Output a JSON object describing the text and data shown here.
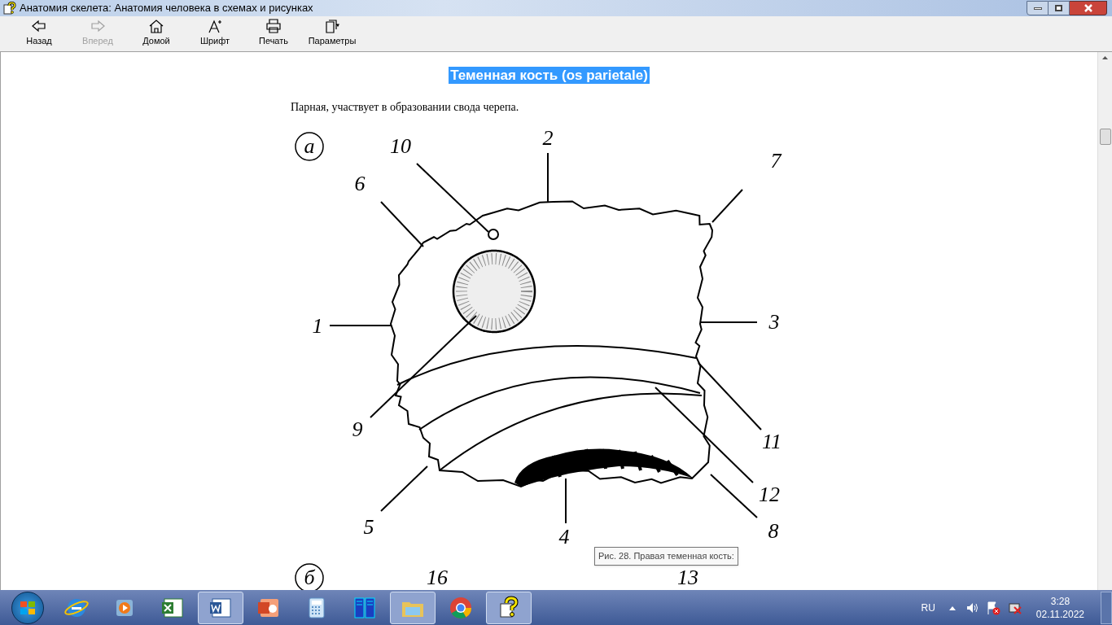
{
  "window": {
    "title": "Анатомия скелета: Анатомия человека в схемах и рисунках"
  },
  "toolbar": [
    {
      "kind": "back",
      "label": "Назад",
      "disabled": false
    },
    {
      "kind": "forward",
      "label": "Вперед",
      "disabled": true
    },
    {
      "kind": "home",
      "label": "Домой",
      "disabled": false
    },
    {
      "kind": "font",
      "label": "Шрифт",
      "disabled": false
    },
    {
      "kind": "print",
      "label": "Печать",
      "disabled": false
    },
    {
      "kind": "options",
      "label": "Параметры",
      "disabled": false
    }
  ],
  "page": {
    "heading": "Теменная кость (os parietale)",
    "intro": "Парная, участвует в образовании свода черепа.",
    "figure_labels": [
      "а",
      "10",
      "2",
      "7",
      "6",
      "1",
      "3",
      "9",
      "11",
      "12",
      "5",
      "4",
      "8",
      "б",
      "16",
      "13"
    ],
    "tooltip": "Рис. 28. Правая теменная кость:"
  },
  "taskbar": {
    "apps": [
      {
        "kind": "ie",
        "open": false
      },
      {
        "kind": "media",
        "open": false
      },
      {
        "kind": "excel",
        "open": false
      },
      {
        "kind": "word",
        "open": true
      },
      {
        "kind": "powerpoint",
        "open": false
      },
      {
        "kind": "calculator",
        "open": false
      },
      {
        "kind": "server",
        "open": false
      },
      {
        "kind": "explorer",
        "open": true
      },
      {
        "kind": "chrome",
        "open": false
      },
      {
        "kind": "help",
        "open": true
      }
    ],
    "language": "RU",
    "time": "3:28",
    "date": "02.11.2022"
  }
}
